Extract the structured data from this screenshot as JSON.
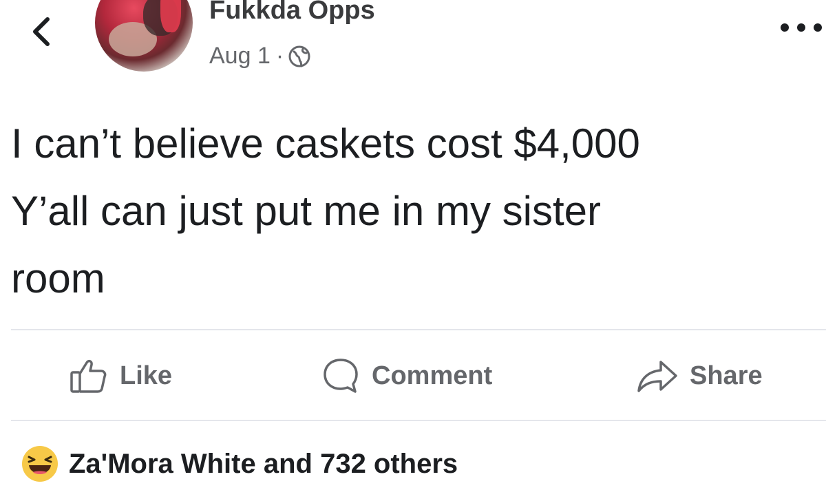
{
  "post": {
    "author": "Fukkda Opps",
    "date": "Aug 1",
    "separator": "·",
    "privacy_icon": "globe-icon",
    "text_lines": [
      "I can’t believe caskets cost $4,000",
      "Y’all can just put me in my sister",
      "room"
    ]
  },
  "actions": {
    "like_label": "Like",
    "comment_label": "Comment",
    "share_label": "Share"
  },
  "reactions": {
    "emoji": "laughing-emoji-icon",
    "summary": "Za'Mora White and 732 others"
  },
  "colors": {
    "text": "#1c1e21",
    "secondary": "#65676b",
    "divider": "#e4e6eb",
    "reaction_yellow": "#f7c948"
  }
}
